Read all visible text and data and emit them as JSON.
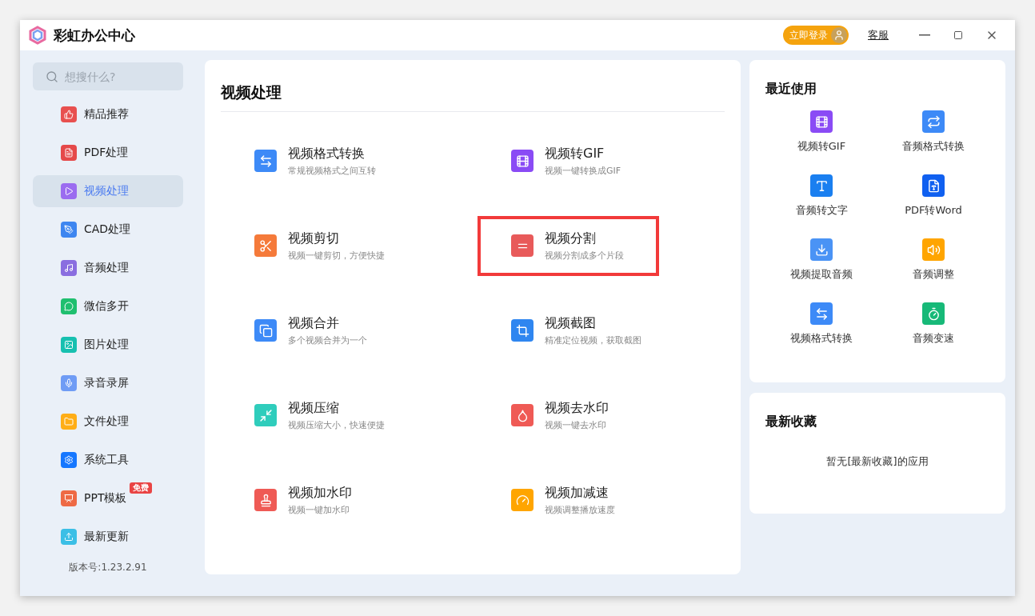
{
  "window": {
    "title": "彩虹办公中心",
    "login_button": "立即登录",
    "service_link": "客服"
  },
  "sidebar": {
    "search": {
      "placeholder": "想搜什么?"
    },
    "items": [
      {
        "label": "精品推荐",
        "selected": false,
        "color": "#e8504f"
      },
      {
        "label": "PDF处理",
        "selected": false,
        "color": "#e5494a"
      },
      {
        "label": "视频处理",
        "selected": true,
        "color": "#9b6cf0"
      },
      {
        "label": "CAD处理",
        "selected": false,
        "color": "#3e86f0"
      },
      {
        "label": "音频处理",
        "selected": false,
        "color": "#8a6ee0"
      },
      {
        "label": "微信多开",
        "selected": false,
        "color": "#1fbf6f"
      },
      {
        "label": "图片处理",
        "selected": false,
        "color": "#17c0b0"
      },
      {
        "label": "录音录屏",
        "selected": false,
        "color": "#6f9cf5"
      },
      {
        "label": "文件处理",
        "selected": false,
        "color": "#ffae17"
      },
      {
        "label": "系统工具",
        "selected": false,
        "color": "#1677ff"
      },
      {
        "label": "PPT模板",
        "selected": false,
        "color": "#ee6a45",
        "badge": "免费"
      },
      {
        "label": "最新更新",
        "selected": false,
        "color": "#3bbfe6"
      }
    ],
    "version": "版本号:1.23.2.91"
  },
  "main": {
    "title": "视频处理",
    "tools": [
      {
        "title": "视频格式转换",
        "subtitle": "常规视频格式之间互转",
        "highlighted": false,
        "color": "#3d8af7"
      },
      {
        "title": "视频转GIF",
        "subtitle": "视频一键转换成GIF",
        "highlighted": false,
        "color": "#8a4bf5"
      },
      {
        "title": "视频剪切",
        "subtitle": "视频一键剪切，方便快捷",
        "highlighted": false,
        "color": "#f57a3a"
      },
      {
        "title": "视频分割",
        "subtitle": "视频分割成多个片段",
        "highlighted": true,
        "color": "#e85a5a"
      },
      {
        "title": "视频合并",
        "subtitle": "多个视频合并为一个",
        "highlighted": false,
        "color": "#3d8af7"
      },
      {
        "title": "视频截图",
        "subtitle": "精准定位视频，获取截图",
        "highlighted": false,
        "color": "#2f86f0"
      },
      {
        "title": "视频压缩",
        "subtitle": "视频压缩大小，快速便捷",
        "highlighted": false,
        "color": "#2fcdbc"
      },
      {
        "title": "视频去水印",
        "subtitle": "视频一键去水印",
        "highlighted": false,
        "color": "#ef5a55"
      },
      {
        "title": "视频加水印",
        "subtitle": "视频一键加水印",
        "highlighted": false,
        "color": "#ef5a55"
      },
      {
        "title": "视频加减速",
        "subtitle": "视频调整播放速度",
        "highlighted": false,
        "color": "#ffa500"
      }
    ]
  },
  "recent": {
    "title": "最近使用",
    "items": [
      {
        "label": "视频转GIF",
        "color": "#8a4bf5"
      },
      {
        "label": "音频格式转换",
        "color": "#3d8af7"
      },
      {
        "label": "音频转文字",
        "color": "#1a7ff0"
      },
      {
        "label": "PDF转Word",
        "color": "#1060f0"
      },
      {
        "label": "视频提取音频",
        "color": "#4a93f5"
      },
      {
        "label": "音频调整",
        "color": "#ffa500"
      },
      {
        "label": "视频格式转换",
        "color": "#3d8af7"
      },
      {
        "label": "音频变速",
        "color": "#17b978"
      }
    ]
  },
  "favorites": {
    "title": "最新收藏",
    "empty_text": "暂无[最新收藏]的应用"
  }
}
